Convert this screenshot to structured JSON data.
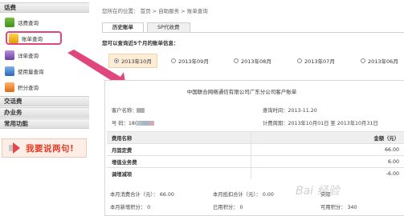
{
  "sidebar": {
    "section1": "话费",
    "items": [
      {
        "label": "话费查询",
        "icon": "phone-bill-icon"
      },
      {
        "label": "账单查询",
        "icon": "bill-icon"
      },
      {
        "label": "详单查询",
        "icon": "detail-list-icon"
      },
      {
        "label": "使用量查询",
        "icon": "usage-icon"
      },
      {
        "label": "积分查询",
        "icon": "points-icon"
      }
    ],
    "section2": "交话费",
    "section3": "办业务",
    "section4": "常用功能",
    "promo": "我要说两句!"
  },
  "breadcrumb": "您所在的位置： 首页 > 自助服务 > 账单查询",
  "tabs": [
    "历史账单",
    "SP代收费"
  ],
  "query_label": "您可以查询近5个月的账单信息：",
  "months": [
    "2013年10月",
    "2013年09月",
    "2013年08月",
    "2013年07月",
    "2013年06月"
  ],
  "selected_month": "2013年10月",
  "bill": {
    "title": "中国联合网络通信有限公司广东分公司客户账单",
    "customer_label": "客户名称：",
    "number_label": "号    码：18(",
    "query_time": "查询时间：2013-11.20",
    "period": "计费周期：2013年10月01日  至  2013年10月31日",
    "header_item": "费用名称",
    "header_amount": "金额（元）",
    "rows": [
      {
        "name": "月固定费",
        "amount": "66.00"
      },
      {
        "name": "增值业务费",
        "amount": "6.00"
      },
      {
        "name": "调增减项",
        "amount": "-6.00"
      }
    ],
    "summary": {
      "monthly_total": "本月消费合计（元）：   66.00",
      "monthly_deduct": "本月抵扣合计（元）：   0.00",
      "actual_label": "实际",
      "new_points": "本月新增积分：      0",
      "used_points": "已用积分：      0",
      "available_points": "可用积分：   340"
    }
  },
  "watermark": "Bai 经验"
}
